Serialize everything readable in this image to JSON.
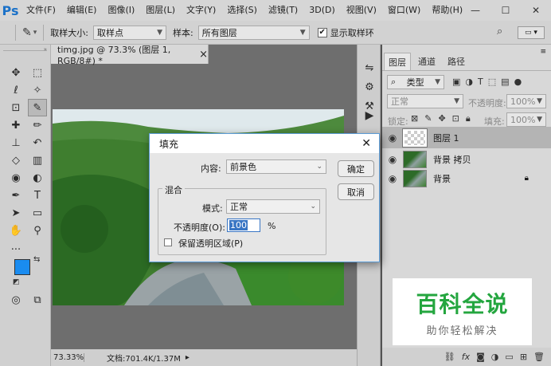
{
  "app": {
    "logo": "Ps"
  },
  "menu": [
    "文件(F)",
    "编辑(E)",
    "图像(I)",
    "图层(L)",
    "文字(Y)",
    "选择(S)",
    "滤镜(T)",
    "3D(D)",
    "视图(V)",
    "窗口(W)",
    "帮助(H)"
  ],
  "window_controls": {
    "minimize": "—",
    "maximize": "☐",
    "close": "✕"
  },
  "options": {
    "sample_size_label": "取样大小:",
    "sample_size_value": "取样点",
    "sample_label": "样本:",
    "sample_value": "所有图层",
    "show_ring_label": "显示取样环",
    "show_ring_checked": true
  },
  "document": {
    "tab_title": "timg.jpg @ 73.3% (图层 1, RGB/8#) *",
    "tab_close": "×",
    "zoom": "73.33%",
    "doc_info": "文档:701.4K/1.37M"
  },
  "panels": {
    "tabs": [
      "图层",
      "通道",
      "路径"
    ],
    "kind_filter": "类型",
    "blend_mode": "正常",
    "opacity_label": "不透明度:",
    "opacity_value": "100%",
    "lock_label": "锁定:",
    "fill_label": "填充:",
    "fill_value": "100%",
    "layers": [
      {
        "name": "图层 1",
        "selected": true,
        "locked": false
      },
      {
        "name": "背景 拷贝",
        "selected": false,
        "locked": false
      },
      {
        "name": "背景",
        "selected": false,
        "locked": true
      }
    ]
  },
  "dialog": {
    "title": "填充",
    "content_label": "内容:",
    "content_value": "前景色",
    "blend_group": "混合",
    "mode_label": "模式:",
    "mode_value": "正常",
    "opacity_label": "不透明度(O):",
    "opacity_value": "100",
    "opacity_unit": "%",
    "preserve_label": "保留透明区域(P)",
    "ok": "确定",
    "cancel": "取消"
  },
  "watermark": {
    "main": "百科全说",
    "sub": "助你轻松解决"
  },
  "colors": {
    "foreground": "#1a8cf0",
    "background": "#ffffff",
    "accent": "#1c72c8",
    "watermark_green": "#24a63f"
  }
}
